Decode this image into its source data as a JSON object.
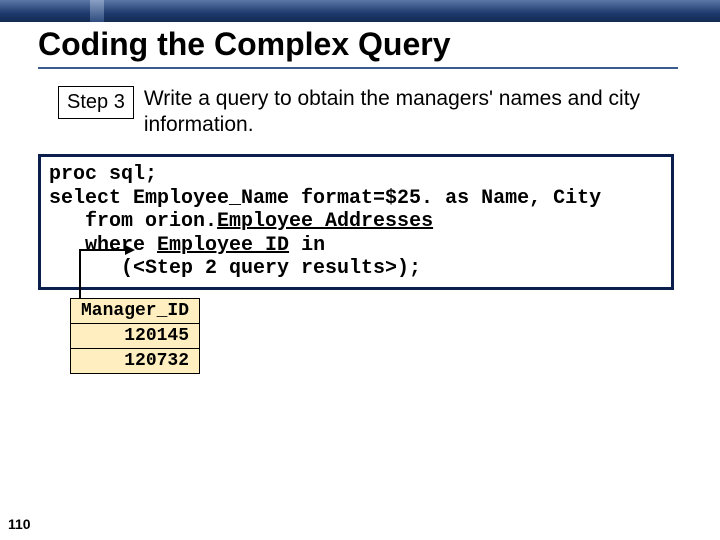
{
  "title": "Coding the Complex Query",
  "step": {
    "badge": "Step 3",
    "text": "Write a query to obtain the managers' names and city information."
  },
  "code": {
    "l1": "proc sql;",
    "l2": "select Employee_Name format=$25. as Name, City",
    "l3a": "   from orion.",
    "l3b": "Employee_Addresses",
    "l4a": "   where ",
    "l4b": "Employee_ID",
    "l4c": " in",
    "l5": "      (<Step 2 query results>);"
  },
  "table": {
    "header": "Manager_ID",
    "rows": [
      "120145",
      "120732"
    ]
  },
  "page": "110"
}
